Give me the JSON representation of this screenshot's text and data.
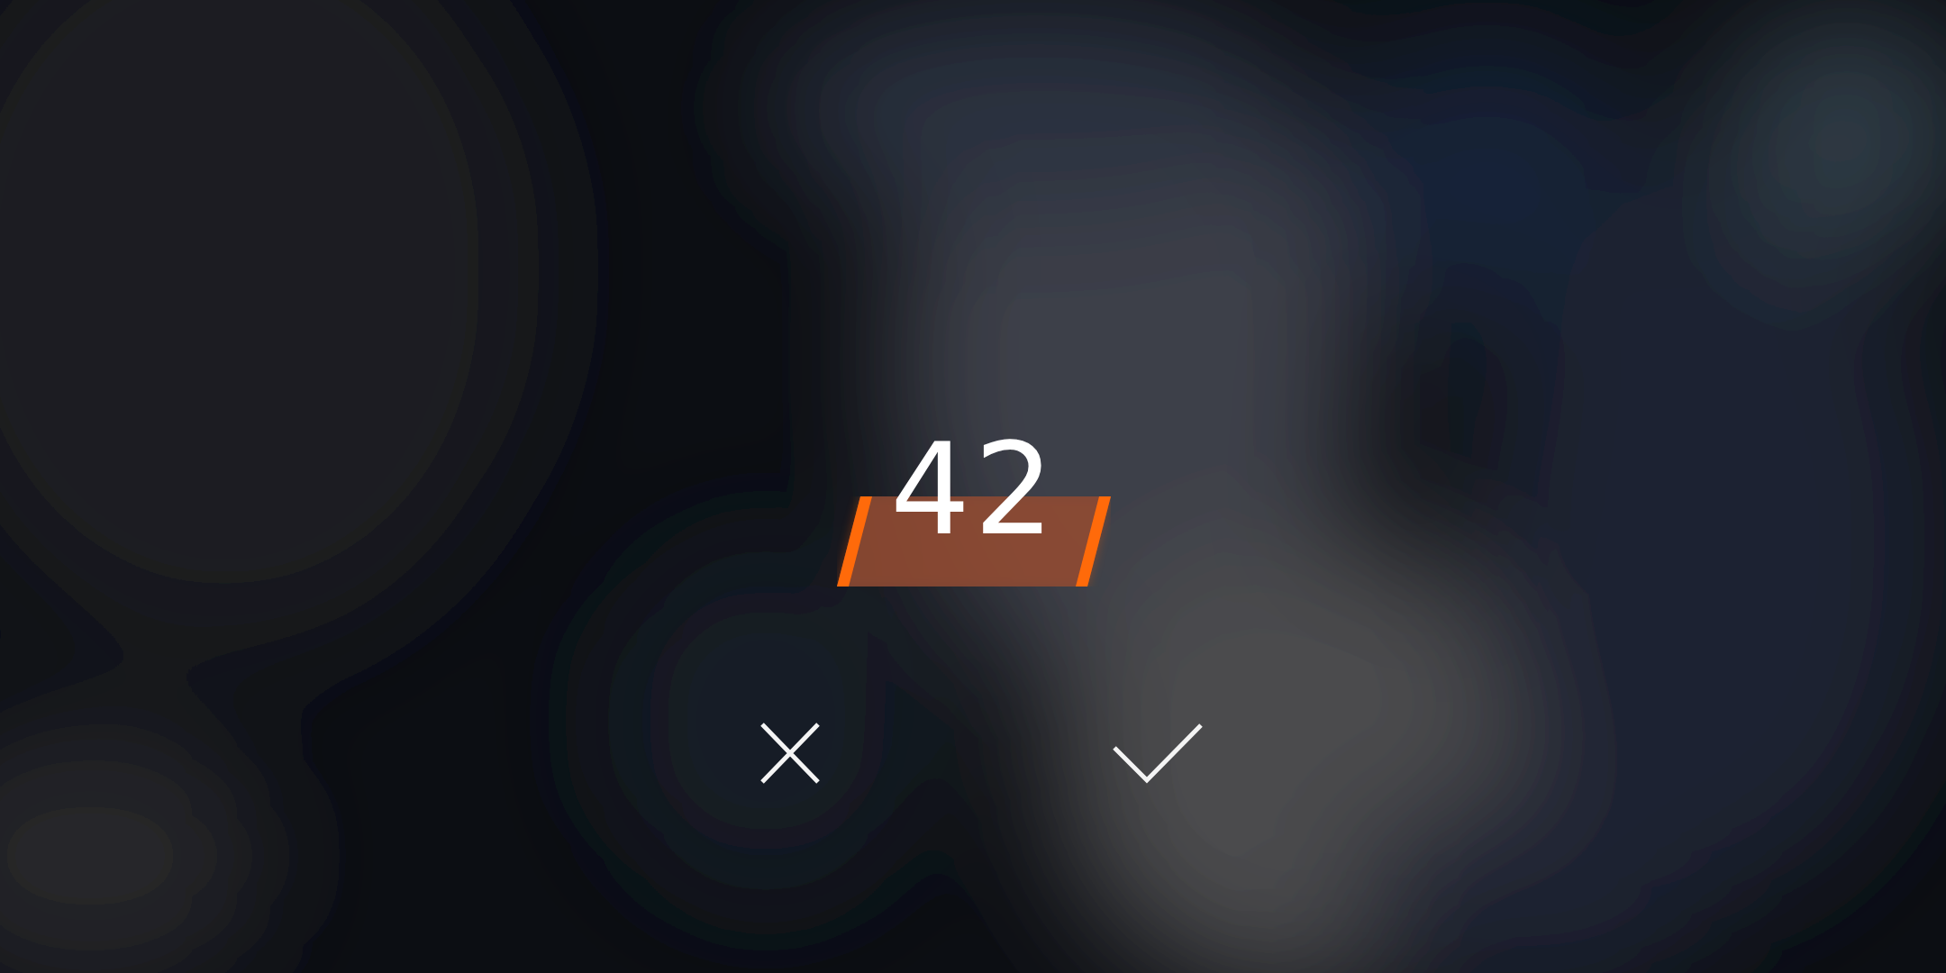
{
  "counter": {
    "value": "42"
  },
  "actions": [
    {
      "kind": "cancel"
    },
    {
      "kind": "confirm"
    }
  ]
}
